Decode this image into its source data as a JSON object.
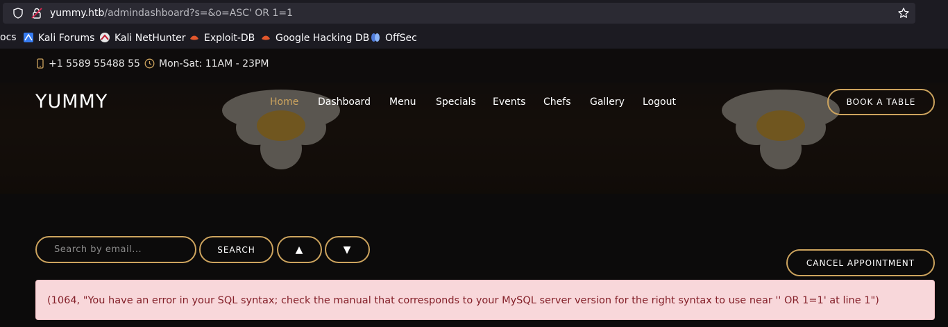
{
  "browser": {
    "url_host": "yummy.htb",
    "url_path": "/admindashboard?s=&o=ASC' OR 1=1",
    "bookmarks": [
      {
        "label": "ocs",
        "icon": "docs-icon"
      },
      {
        "label": "Kali Forums",
        "icon": "kali-forums-icon"
      },
      {
        "label": "Kali NetHunter",
        "icon": "nethunter-icon"
      },
      {
        "label": "Exploit-DB",
        "icon": "exploit-db-icon"
      },
      {
        "label": "Google Hacking DB",
        "icon": "ghdb-icon"
      },
      {
        "label": "OffSec",
        "icon": "offsec-icon"
      }
    ]
  },
  "topbar": {
    "phone": "+1 5589 55488 55",
    "hours": "Mon-Sat: 11AM - 23PM"
  },
  "header": {
    "brand": "YUMMY",
    "nav": [
      "Home",
      "Dashboard",
      "Menu",
      "Specials",
      "Events",
      "Chefs",
      "Gallery",
      "Logout"
    ],
    "active_nav": "Home",
    "book_label": "BOOK A TABLE"
  },
  "dashboard": {
    "search_placeholder": "Search by email...",
    "search_label": "SEARCH",
    "sort_asc_label": "▲",
    "sort_desc_label": "▼",
    "cancel_label": "CANCEL APPOINTMENT",
    "error_message": "(1064, \"You have an error in your SQL syntax; check the manual that corresponds to your MySQL server version for the right syntax to use near '' OR 1=1' at line 1\")"
  },
  "colors": {
    "accent": "#cda45e",
    "alert_bg": "#f8d7da",
    "alert_text": "#842029"
  }
}
